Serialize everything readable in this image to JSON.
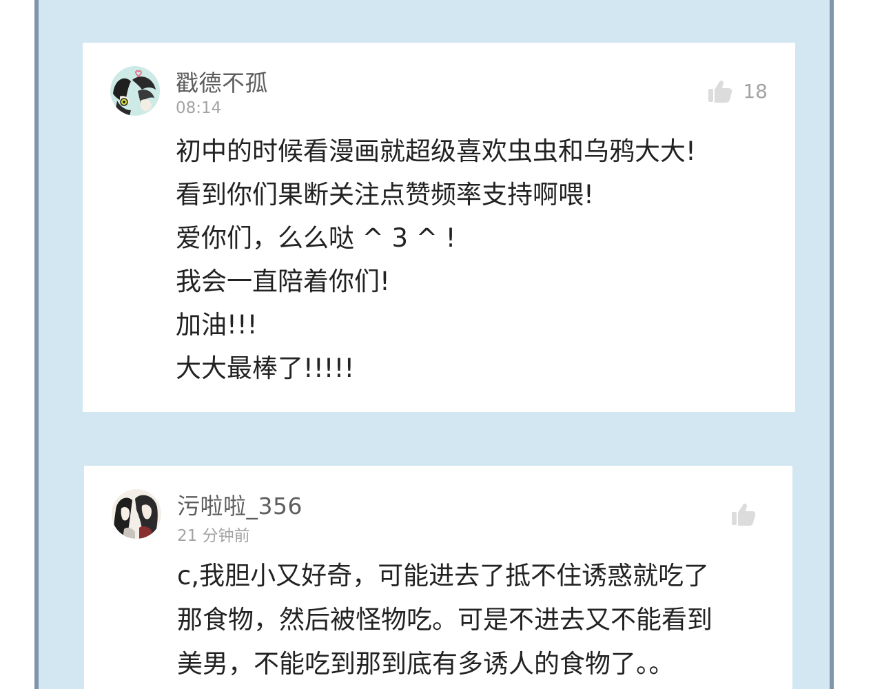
{
  "comments": [
    {
      "username": "戳德不孤",
      "time": "08:14",
      "likes": "18",
      "avatar_icon": "user-avatar-icon",
      "like_icon": "thumbs-up-icon",
      "lines": [
        "初中的时候看漫画就超级喜欢虫虫和乌鸦大大!",
        "看到你们果断关注点赞频率支持啊喂!",
        "爱你们，么么哒 ^ 3 ^ !",
        "我会一直陪着你们!",
        "加油!!!",
        "大大最棒了!!!!!"
      ]
    },
    {
      "username": "污啦啦_356",
      "time": "21 分钟前",
      "likes": "",
      "avatar_icon": "user-avatar-icon",
      "like_icon": "thumbs-up-icon",
      "lines": [
        "c,我胆小又好奇，可能进去了抵不住诱惑就吃了",
        "那食物，然后被怪物吃。可是不进去又不能看到",
        "美男，不能吃到那到底有多诱人的食物了。。"
      ]
    }
  ],
  "colors": {
    "background": "#d2e7f1",
    "border": "#7f95a9",
    "card": "#ffffff",
    "username": "#5e5e5e",
    "meta": "#a3a3a3",
    "text": "#222222",
    "like_icon": "#dcdcdc"
  }
}
